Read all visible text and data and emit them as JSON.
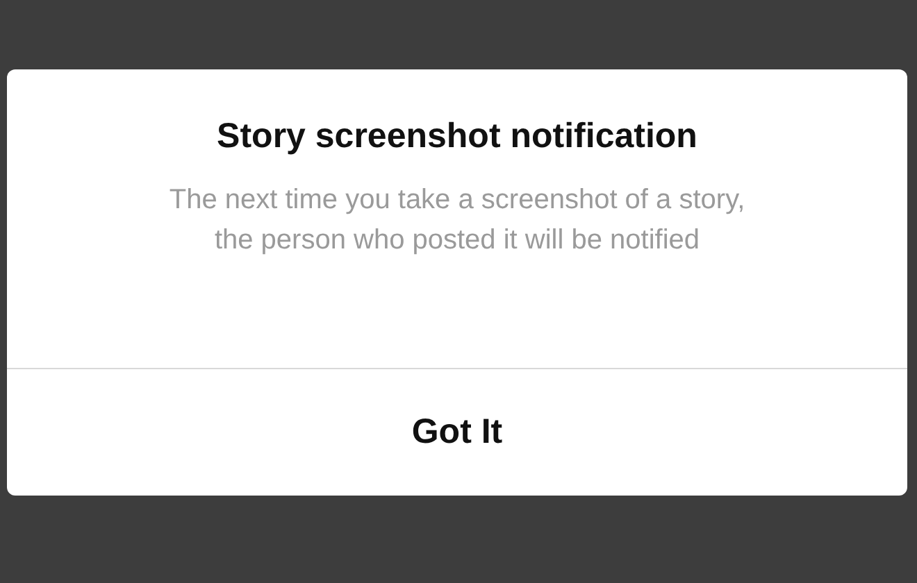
{
  "dialog": {
    "title": "Story screenshot notification",
    "message": "The next time you take a screenshot of a story, the person who posted it will be notified",
    "button": "Got It"
  }
}
